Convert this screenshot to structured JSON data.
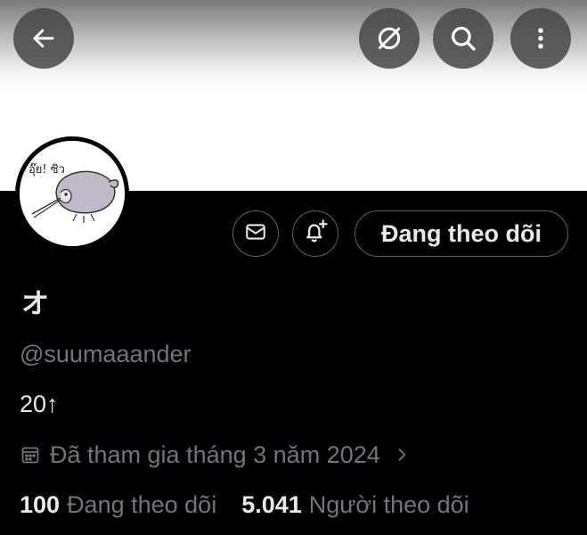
{
  "header": {
    "icons": {
      "back": "arrow-left-icon",
      "translate": "no-translate-icon",
      "search": "search-icon",
      "more": "more-vertical-icon"
    }
  },
  "profile": {
    "display_name": "オ",
    "handle": "@suumaaander",
    "bio": "20↑",
    "joined": "Đã tham gia tháng 3 năm 2024",
    "avatar_text": "อุ๊ย! ซิว"
  },
  "actions": {
    "message_icon": "envelope-icon",
    "notify_icon": "bell-plus-icon",
    "follow_label": "Đang theo dõi"
  },
  "stats": {
    "following_count": "100",
    "following_label": "Đang theo dõi",
    "followers_count": "5.041",
    "followers_label": "Người theo dõi"
  },
  "colors": {
    "background": "#000000",
    "primary_text": "#e7e9ea",
    "secondary_text": "#71767b",
    "border": "#5f6368"
  }
}
